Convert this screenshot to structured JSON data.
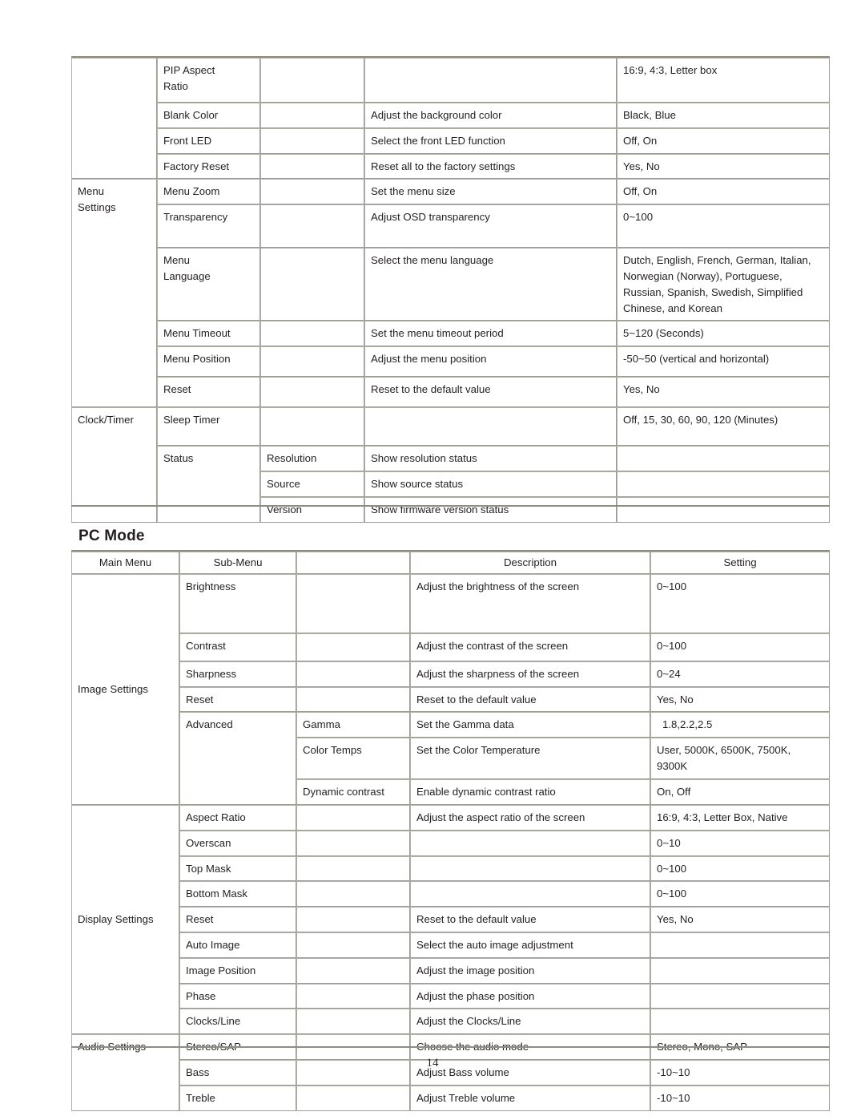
{
  "document": {
    "page_number": "14",
    "section_title": "PC Mode"
  },
  "table_tv": {
    "columns": [
      "Main Menu",
      "Sub-Menu",
      "",
      "Description",
      "Setting"
    ],
    "rows": [
      {
        "main": "",
        "sub": "PIP Aspect Ratio",
        "third": "",
        "desc": "",
        "setting": "16:9, 4:3, Letter box",
        "tall": true
      },
      {
        "main": "",
        "sub": "Blank Color",
        "third": "",
        "desc": "Adjust the background color",
        "setting": "Black, Blue"
      },
      {
        "main": "",
        "sub": "Front LED",
        "third": "",
        "desc": "Select the front LED function",
        "setting": "Off, On"
      },
      {
        "main": "",
        "sub": "Factory Reset",
        "third": "",
        "desc": "Reset all to the factory settings",
        "setting": "Yes, No"
      },
      {
        "main": "Menu Settings",
        "sub": "Menu Zoom",
        "third": "",
        "desc": "Set the menu size",
        "setting": "Off, On"
      },
      {
        "main": "",
        "sub": "Transparency",
        "third": "",
        "desc": "Adjust OSD transparency",
        "setting": "0~100"
      },
      {
        "main": "",
        "sub": "Menu Language",
        "third": "",
        "desc": "Select the menu language",
        "setting": "Dutch, English, French, German, Italian, Norwegian (Norway), Portuguese, Russian, Spanish, Swedish, Simplified Chinese, and Korean"
      },
      {
        "main": "",
        "sub": "Menu Timeout",
        "third": "",
        "desc": "Set the menu timeout period",
        "setting": "5~120 (Seconds)"
      },
      {
        "main": "",
        "sub": "Menu Position",
        "third": "",
        "desc": "Adjust the menu position",
        "setting": "-50~50 (vertical and horizontal)"
      },
      {
        "main": "",
        "sub": "Reset",
        "third": "",
        "desc": "Reset to the default value",
        "setting": "Yes, No"
      },
      {
        "main": "Clock/Timer",
        "sub": "Sleep Timer",
        "third": "",
        "desc": "",
        "setting": "Off, 15, 30, 60, 90, 120 (Minutes)"
      },
      {
        "main": "",
        "sub": "Status",
        "third": "Resolution",
        "desc": "Show resolution status",
        "setting": ""
      },
      {
        "main": "",
        "sub": "",
        "third": "Source",
        "desc": "Show source status",
        "setting": ""
      },
      {
        "main": "",
        "sub": "",
        "third": "Version",
        "desc": "Show firmware version status",
        "setting": ""
      }
    ],
    "cells": {
      "r0_sub": "PIP Aspect\nRatio",
      "r4_main": "Menu\nSettings",
      "r6_sub": "Menu\nLanguage"
    }
  },
  "table_pc": {
    "columns": [
      "Main Menu",
      "Sub-Menu",
      "",
      "Description",
      "Setting"
    ],
    "rows": [
      {
        "main": "Image Settings",
        "sub": "Brightness",
        "third": "",
        "desc": "Adjust the brightness of the screen",
        "setting": "0~100"
      },
      {
        "main": "",
        "sub": "Contrast",
        "third": "",
        "desc": "Adjust the contrast of the screen",
        "setting": "0~100"
      },
      {
        "main": "",
        "sub": "Sharpness",
        "third": "",
        "desc": "Adjust the sharpness of the screen",
        "setting": "0~24"
      },
      {
        "main": "",
        "sub": "Reset",
        "third": "",
        "desc": "Reset to the default value",
        "setting": "Yes, No"
      },
      {
        "main": "",
        "sub": "Advanced",
        "third": "Gamma",
        "desc": "Set the Gamma data",
        "setting": "1.8,2.2,2.5"
      },
      {
        "main": "",
        "sub": "",
        "third": "Color Temps",
        "desc": "Set the Color Temperature",
        "setting": "User, 5000K, 6500K, 7500K, 9300K"
      },
      {
        "main": "",
        "sub": "",
        "third": "Dynamic contrast",
        "desc": "Enable dynamic contrast ratio",
        "setting": "On, Off"
      },
      {
        "main": "Display Settings",
        "sub": "Aspect Ratio",
        "third": "",
        "desc": "Adjust the aspect ratio of the screen",
        "setting": "16:9, 4:3, Letter Box, Native"
      },
      {
        "main": "",
        "sub": "Overscan",
        "third": "",
        "desc": "",
        "setting": "0~10"
      },
      {
        "main": "",
        "sub": "Top Mask",
        "third": "",
        "desc": "",
        "setting": "0~100"
      },
      {
        "main": "",
        "sub": "Bottom Mask",
        "third": "",
        "desc": "",
        "setting": "0~100"
      },
      {
        "main": "",
        "sub": "Reset",
        "third": "",
        "desc": "Reset to the default value",
        "setting": "Yes, No"
      },
      {
        "main": "",
        "sub": "Auto Image",
        "third": "",
        "desc": "Select the auto image adjustment",
        "setting": ""
      },
      {
        "main": "",
        "sub": "Image Position",
        "third": "",
        "desc": "Adjust the image position",
        "setting": ""
      },
      {
        "main": "",
        "sub": "Phase",
        "third": "",
        "desc": "Adjust the phase position",
        "setting": ""
      },
      {
        "main": "",
        "sub": "Clocks/Line",
        "third": "",
        "desc": "Adjust the Clocks/Line",
        "setting": ""
      },
      {
        "main": "Audio Settings",
        "sub": "Stereo/SAP",
        "third": "",
        "desc": "Choose the audio mode",
        "setting": "Stereo, Mono, SAP"
      },
      {
        "main": "",
        "sub": "Bass",
        "third": "",
        "desc": "Adjust Bass volume",
        "setting": "-10~10"
      },
      {
        "main": "",
        "sub": "Treble",
        "third": "",
        "desc": "Adjust Treble volume",
        "setting": "-10~10"
      }
    ]
  }
}
